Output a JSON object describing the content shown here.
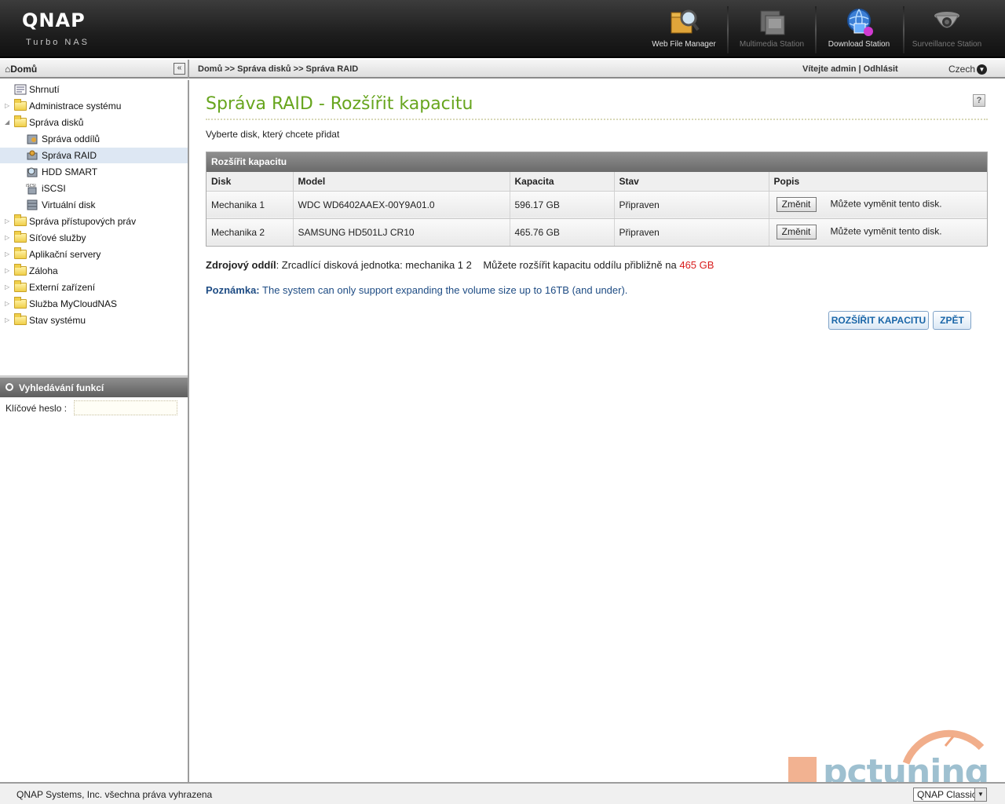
{
  "header": {
    "logo": "QNAP",
    "logo_sub": "Turbo NAS",
    "apps": [
      {
        "label": "Web File Manager",
        "icon": "web-file-manager-icon"
      },
      {
        "label": "Multimedia Station",
        "icon": "multimedia-station-icon"
      },
      {
        "label": "Download Station",
        "icon": "download-station-icon"
      },
      {
        "label": "Surveillance Station",
        "icon": "surveillance-station-icon"
      }
    ]
  },
  "topbar": {
    "home": "Domů",
    "breadcrumb": "Domů >> Správa disků >> Správa RAID",
    "welcome": "Vítejte admin",
    "separator": "|",
    "logout": "Odhlásit",
    "language": "Czech"
  },
  "sidebar": {
    "items": [
      {
        "label": "Shrnutí",
        "icon": "summary-icon"
      },
      {
        "label": "Administrace systému",
        "icon": "folder-icon"
      },
      {
        "label": "Správa disků",
        "icon": "folder-open-icon"
      },
      {
        "label": "Správa oddílů",
        "icon": "volume-management-icon"
      },
      {
        "label": "Správa RAID",
        "icon": "raid-management-icon"
      },
      {
        "label": "HDD SMART",
        "icon": "hdd-smart-icon"
      },
      {
        "label": "iSCSI",
        "icon": "iscsi-icon"
      },
      {
        "label": "Virtuální disk",
        "icon": "virtual-disk-icon"
      },
      {
        "label": "Správa přístupových práv",
        "icon": "folder-icon"
      },
      {
        "label": "Síťové služby",
        "icon": "folder-icon"
      },
      {
        "label": "Aplikační servery",
        "icon": "folder-icon"
      },
      {
        "label": "Záloha",
        "icon": "folder-icon"
      },
      {
        "label": "Externí zařízení",
        "icon": "folder-icon"
      },
      {
        "label": "Služba MyCloudNAS",
        "icon": "folder-icon"
      },
      {
        "label": "Stav systému",
        "icon": "folder-icon"
      }
    ],
    "search_title": "Vyhledávání funkcí",
    "keyword_label": "Klíčové heslo :",
    "keyword_value": ""
  },
  "main": {
    "title": "Správa RAID - Rozšířit kapacitu",
    "help": "?",
    "instruction": "Vyberte disk, který chcete přidat",
    "table": {
      "caption": "Rozšířit kapacitu",
      "columns": [
        "Disk",
        "Model",
        "Kapacita",
        "Stav",
        "Popis"
      ],
      "rows": [
        {
          "disk": "Mechanika 1",
          "model": "WDC WD6402AAEX-00Y9A01.0",
          "capacity": "596.17 GB",
          "status": "Připraven",
          "button": "Změnit",
          "desc": "Můžete vyměnit tento disk."
        },
        {
          "disk": "Mechanika 2",
          "model": "SAMSUNG HD501LJ CR10",
          "capacity": "465.76 GB",
          "status": "Připraven",
          "button": "Změnit",
          "desc": "Můžete vyměnit tento disk."
        }
      ]
    },
    "source_label": "Zdrojový oddíl",
    "source_value": ": Zrcadlící disková jednotka: mechanika 1 2",
    "expand_text": "Můžete rozšířit kapacitu oddílu přibližně na",
    "expand_value": "465 GB",
    "note_label": "Poznámka:",
    "note_text": "The system can only support expanding the volume size up to 16TB (and under).",
    "expand_button": "ROZŠÍŘIT KAPACITU",
    "back_button": "ZPĚT"
  },
  "footer": {
    "copyright": "QNAP Systems, Inc. všechna práva vyhrazena",
    "skin": "QNAP Classic"
  },
  "watermark": "pctuning",
  "colors": {
    "title_green": "#67a51e",
    "note_blue": "#1e4c84",
    "capacity_red": "#d81c1c",
    "button_blue": "#1a66a8"
  }
}
